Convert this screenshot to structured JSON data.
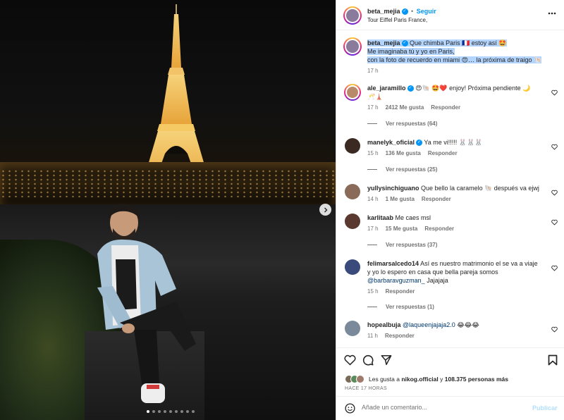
{
  "post": {
    "author": "beta_mejia",
    "follow_label": "Seguir",
    "location": "Tour Eiffel Paris France,",
    "more_icon": "more-horizontal-icon",
    "caption_line1": "Que chimba Paris 🇫🇷 estoy así 🤩",
    "caption_line2": "Me imaginaba tú y yo en Paris,",
    "caption_line3": "con la foto de recuerdo en miami 😍… la próxima de traigo 🐚",
    "caption_time": "17 h"
  },
  "comments": [
    {
      "user": "ale_jaramillo",
      "verified": true,
      "text": "😍🐚 🤩❤️ enjoy! Próxima pendiente 🌙",
      "text2": "🥂🗼",
      "time": "17 h",
      "likes": "2412 Me gusta",
      "reply": "Responder",
      "view_replies": "Ver respuestas (64)",
      "avatar_color": "#b88a6a"
    },
    {
      "user": "manelyk_oficial",
      "verified": true,
      "text": "Ya me vi!!!!! 🐰🐰🐰",
      "time": "15 h",
      "likes": "136 Me gusta",
      "reply": "Responder",
      "view_replies": "Ver respuestas (25)",
      "avatar_color": "#3a2a22"
    },
    {
      "user": "yullysinchiguano",
      "verified": false,
      "text": "Que bello la caramelo 🐚 después va ejwj",
      "time": "14 h",
      "likes": "1 Me gusta",
      "reply": "Responder",
      "avatar_color": "#8a6a58"
    },
    {
      "user": "karlitaab",
      "verified": false,
      "text": "Me caes msl",
      "time": "17 h",
      "likes": "15 Me gusta",
      "reply": "Responder",
      "view_replies": "Ver respuestas (37)",
      "avatar_color": "#5a3a30"
    },
    {
      "user": "felimarsalcedo14",
      "verified": false,
      "text": "Así es nuestro matrimonio el se va a viaje y yo lo espero en casa que bella pareja somos",
      "mention": "@barbaravguzman_",
      "text_after": "Jajajaja",
      "time": "15 h",
      "reply": "Responder",
      "view_replies": "Ver respuestas (1)",
      "avatar_color": "#3a4a7a"
    },
    {
      "user": "hopealbuja",
      "verified": false,
      "mention": "@laqueenjajaja2.0",
      "text": "😂😂😂",
      "time": "11 h",
      "reply": "Responder",
      "avatar_color": "#7a8a9a"
    }
  ],
  "actions": {
    "like_icon": "heart-icon",
    "comment_icon": "comment-icon",
    "share_icon": "send-icon",
    "save_icon": "bookmark-icon",
    "liked_by_prefix": "Les gusta a",
    "liked_by_user": "nikog.official",
    "liked_by_suffix": "y",
    "liked_by_count": "108.375 personas más",
    "posted_ago": "HACE 17 HORAS"
  },
  "add_comment": {
    "placeholder": "Añade un comentario...",
    "post_label": "Publicar",
    "emoji_icon": "emoji-icon"
  },
  "photo": {
    "carousel_total": 9,
    "carousel_active": 1
  },
  "colors": {
    "link_blue": "#0095f6",
    "verified_blue": "#0095f6",
    "selection": "#b3d4fc"
  }
}
